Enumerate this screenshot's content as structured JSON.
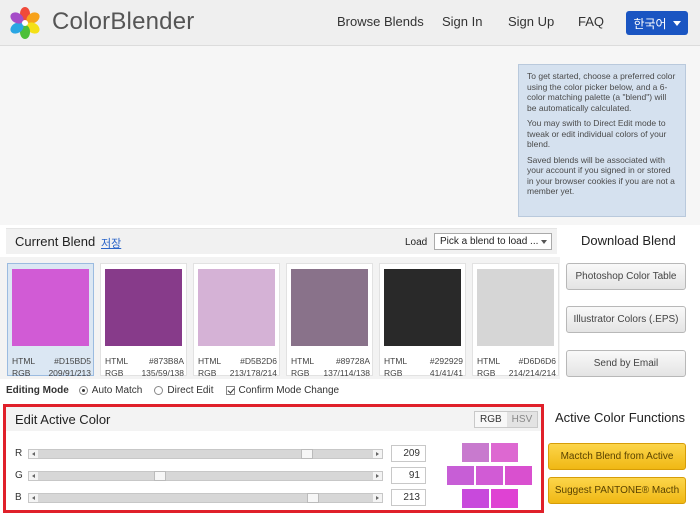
{
  "header": {
    "brand": "ColorBlender",
    "nav": [
      "Browse Blends",
      "Sign In",
      "Sign Up",
      "FAQ"
    ],
    "language": "한국어"
  },
  "info": {
    "p1": "To get started, choose a preferred color using the color picker below, and a 6-color matching palette (a \"blend\") will be automatically calculated.",
    "p2": "You may swith to Direct Edit mode to tweak or edit individual colors of your blend.",
    "p3": "Saved blends will be associated with your account if you signed in or stored in your browser cookies if you are not a member yet."
  },
  "current_blend": {
    "title": "Current Blend",
    "save_link": "저장",
    "load_label": "Load",
    "load_select": "Pick a blend to load ..."
  },
  "swatches": [
    {
      "color": "#D15BD5",
      "html_label": "HTML",
      "html": "#D15BD5",
      "rgb_label": "RGB",
      "rgb": "209/91/213"
    },
    {
      "color": "#873B8A",
      "html_label": "HTML",
      "html": "#873B8A",
      "rgb_label": "RGB",
      "rgb": "135/59/138"
    },
    {
      "color": "#D5B2D6",
      "html_label": "HTML",
      "html": "#D5B2D6",
      "rgb_label": "RGB",
      "rgb": "213/178/214"
    },
    {
      "color": "#89728A",
      "html_label": "HTML",
      "html": "#89728A",
      "rgb_label": "RGB",
      "rgb": "137/114/138"
    },
    {
      "color": "#292929",
      "html_label": "HTML",
      "html": "#292929",
      "rgb_label": "RGB",
      "rgb": "41/41/41"
    },
    {
      "color": "#D6D6D6",
      "html_label": "HTML",
      "html": "#D6D6D6",
      "rgb_label": "RGB",
      "rgb": "214/214/214"
    }
  ],
  "download": {
    "title": "Download Blend",
    "photoshop": "Photoshop Color Table",
    "illustrator": "Illustrator Colors (.EPS)",
    "email": "Send by Email"
  },
  "editing_mode": {
    "label": "Editing Mode",
    "auto": "Auto Match",
    "direct": "Direct Edit",
    "confirm": "Confirm Mode Change"
  },
  "edit_active": {
    "title": "Edit Active Color",
    "tab_rgb": "RGB",
    "tab_hsv": "HSV",
    "r_label": "R",
    "r_value": "209",
    "g_label": "G",
    "g_value": "91",
    "b_label": "B",
    "b_value": "213"
  },
  "functions": {
    "title": "Active Color Functions",
    "match": "Mactch Blend from Active",
    "pantone": "Suggest PANTONE® Macth"
  },
  "colors": {
    "accent_blue": "#1a55c2",
    "highlight_red": "#e0202a",
    "button_yellow": "#f0b814"
  }
}
